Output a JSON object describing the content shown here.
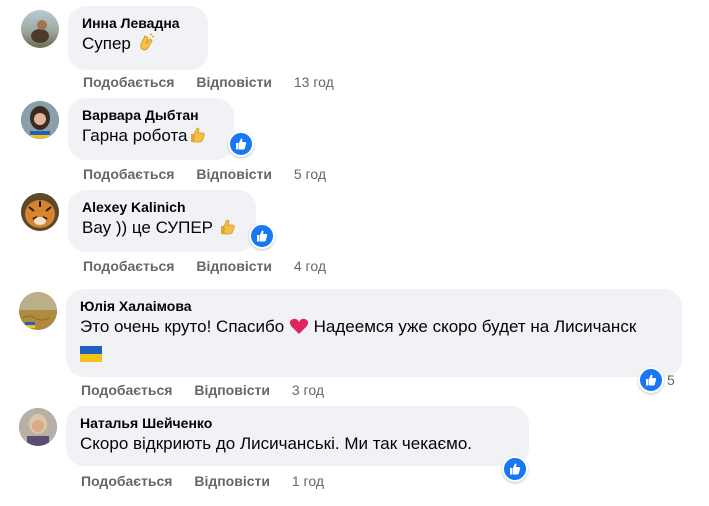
{
  "actions": {
    "like": "Подобається",
    "reply": "Відповісти"
  },
  "comments": [
    {
      "author": "Инна Левадна",
      "text": "Супер",
      "emoji": "clapping-hands",
      "time": "13 год"
    },
    {
      "author": "Варвара Дыбтан",
      "text": "Гарна робота",
      "emoji": "thumbs-up",
      "time": "5 год",
      "reaction": "like"
    },
    {
      "author": "Alexey Kalinich",
      "text": "Вау )) це СУПЕР",
      "emoji": "thumbs-up",
      "time": "4 год",
      "reaction": "like"
    },
    {
      "author": "Юлія Халаімова",
      "text": "Это очень круто! Спасибо",
      "text2": "Надеемся уже скоро будет на Лисичанск",
      "emojis": [
        "red-heart",
        "ukraine-flag"
      ],
      "time": "3 год",
      "reaction": "like",
      "reaction_count": "5"
    },
    {
      "author": "Наталья Шейченко",
      "text": "Скоро відкриють до Лисичанські. Ми так чекаємо.",
      "time": "1 год",
      "reaction": "like"
    }
  ],
  "colors": {
    "bubble": "#f0f2f5",
    "like_blue": "#1877f2",
    "action_gray": "#65676b"
  }
}
